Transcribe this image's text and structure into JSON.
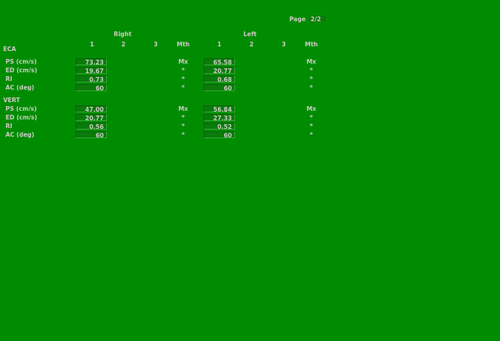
{
  "page": {
    "label": "Page",
    "value": "2/2"
  },
  "headers": {
    "right": "Right",
    "left": "Left",
    "cols": [
      "1",
      "2",
      "3",
      "Mth"
    ]
  },
  "sections": [
    {
      "title": "ECA",
      "rows": [
        {
          "label": "PS (cm/s)",
          "right1": "73.23",
          "right_mth": "Mx",
          "left1": "65.58",
          "left_mth": "Mx"
        },
        {
          "label": "ED (cm/s)",
          "right1": "19.67",
          "right_mth": "*",
          "left1": "20.77",
          "left_mth": "*"
        },
        {
          "label": "RI",
          "right1": "0.73",
          "right_mth": "*",
          "left1": "0.68",
          "left_mth": "*"
        },
        {
          "label": "AC (deg)",
          "right1": "60",
          "right_mth": "*",
          "left1": "60",
          "left_mth": "*"
        }
      ]
    },
    {
      "title": "VERT",
      "rows": [
        {
          "label": "PS (cm/s)",
          "right1": "47.00",
          "right_mth": "Mx",
          "left1": "56.84",
          "left_mth": "Mx"
        },
        {
          "label": "ED (cm/s)",
          "right1": "20.77",
          "right_mth": "*",
          "left1": "27.33",
          "left_mth": "*"
        },
        {
          "label": "RI",
          "right1": "0.56",
          "right_mth": "*",
          "left1": "0.52",
          "left_mth": "*"
        },
        {
          "label": "AC (deg)",
          "right1": "60",
          "right_mth": "*",
          "left1": "60",
          "left_mth": "*"
        }
      ]
    }
  ]
}
